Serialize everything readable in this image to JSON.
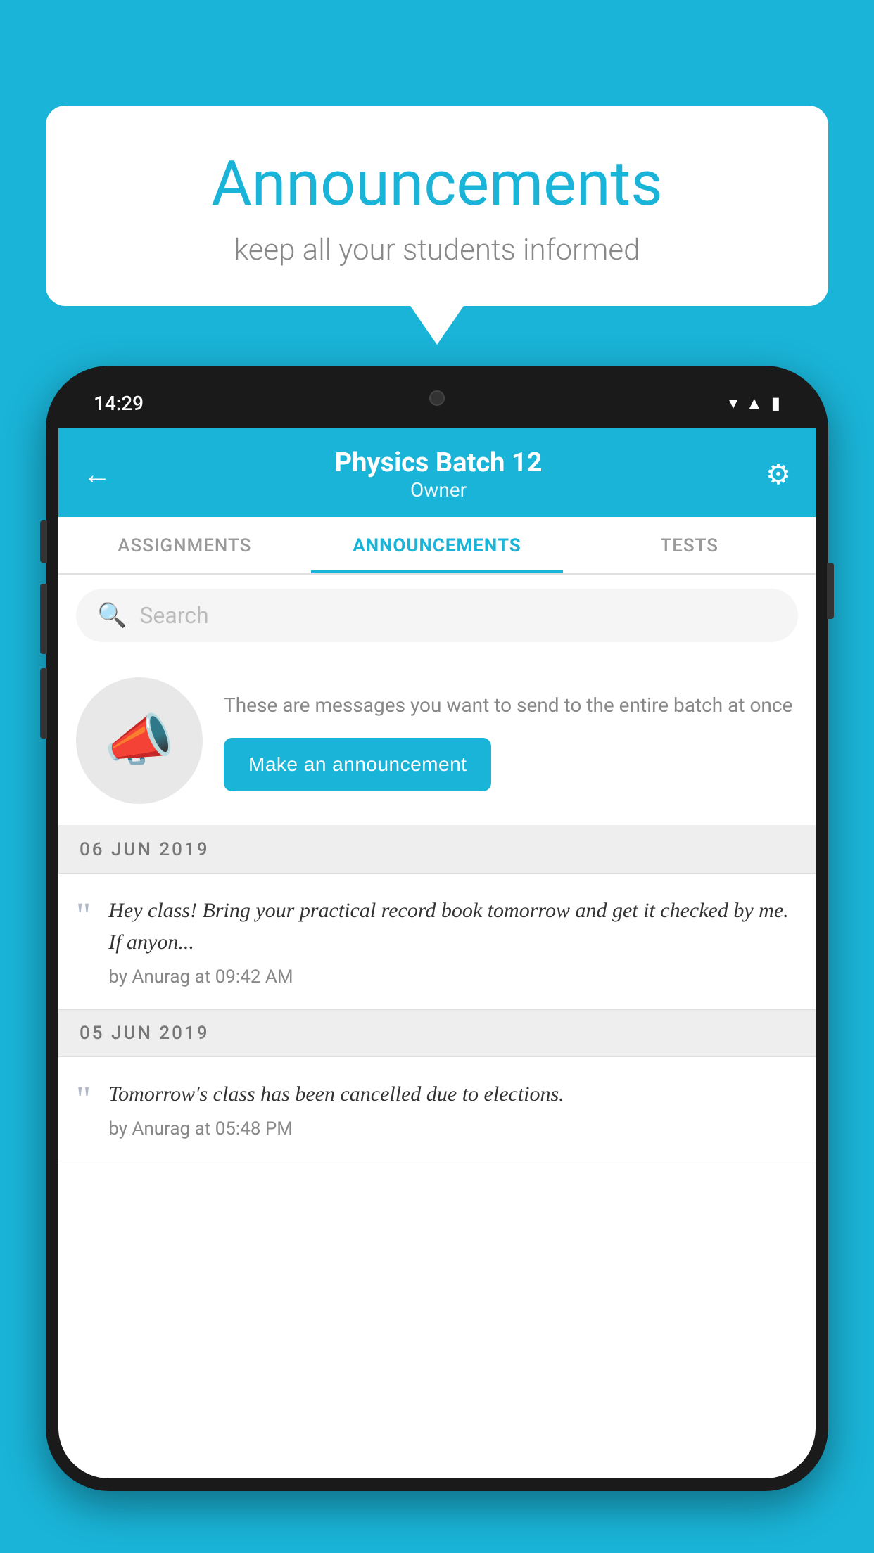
{
  "background_color": "#1ab4d8",
  "speech_bubble": {
    "title": "Announcements",
    "subtitle": "keep all your students informed"
  },
  "phone": {
    "status_bar": {
      "time": "14:29",
      "icons": [
        "wifi",
        "signal",
        "battery"
      ]
    },
    "header": {
      "title": "Physics Batch 12",
      "subtitle": "Owner",
      "back_label": "←",
      "gear_label": "⚙"
    },
    "tabs": [
      {
        "label": "ASSIGNMENTS",
        "active": false
      },
      {
        "label": "ANNOUNCEMENTS",
        "active": true
      },
      {
        "label": "TESTS",
        "active": false
      }
    ],
    "search": {
      "placeholder": "Search"
    },
    "promo": {
      "description": "These are messages you want to send to the entire batch at once",
      "button_label": "Make an announcement"
    },
    "announcements": [
      {
        "date": "06  JUN  2019",
        "text": "Hey class! Bring your practical record book tomorrow and get it checked by me. If anyon...",
        "meta": "by Anurag at 09:42 AM"
      },
      {
        "date": "05  JUN  2019",
        "text": "Tomorrow's class has been cancelled due to elections.",
        "meta": "by Anurag at 05:48 PM"
      }
    ]
  }
}
